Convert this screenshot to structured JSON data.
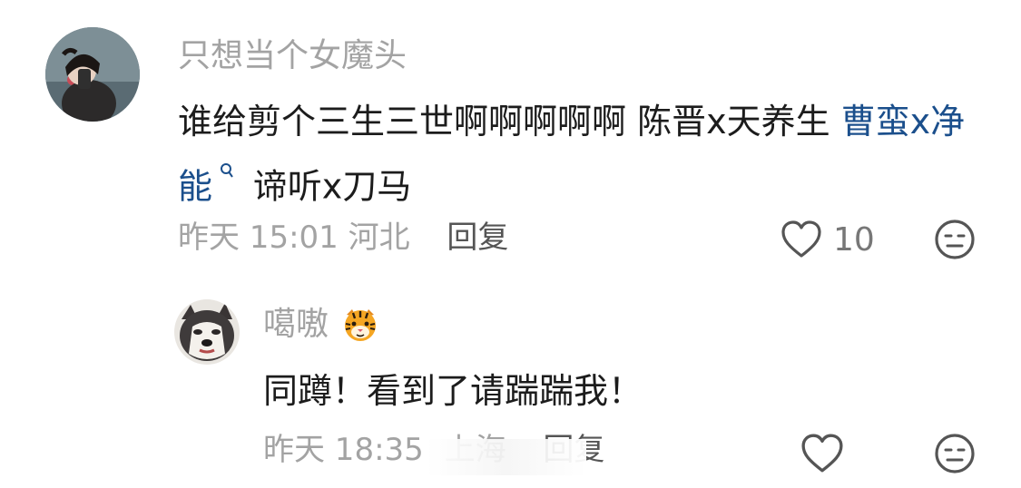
{
  "comment": {
    "username": "只想当个女魔头",
    "content_plain_1": "谁给剪个三生三世啊啊啊啊啊 陈晋x天养生 ",
    "topic_1": "曹蛮x净能",
    "content_plain_2": "谛听x刀马",
    "time": "昨天 15:01",
    "region": "河北",
    "reply_label": "回复",
    "like_count": "10"
  },
  "reply": {
    "username": "噶嗷",
    "content": "同蹲！看到了请踹踹我！",
    "time": "昨天 18:35",
    "region": "上海",
    "reply_label": "回复"
  },
  "colors": {
    "username": "#a3a3a3",
    "body_text": "#1c1c1c",
    "topic_link": "#1b4f8c",
    "meta_text": "#a3a3a3",
    "icon_stroke": "#555555"
  },
  "icons": {
    "like": "heart-outline-icon",
    "react": "neutral-face-icon",
    "badge": "tiger-emoji-icon",
    "search": "search-icon"
  }
}
